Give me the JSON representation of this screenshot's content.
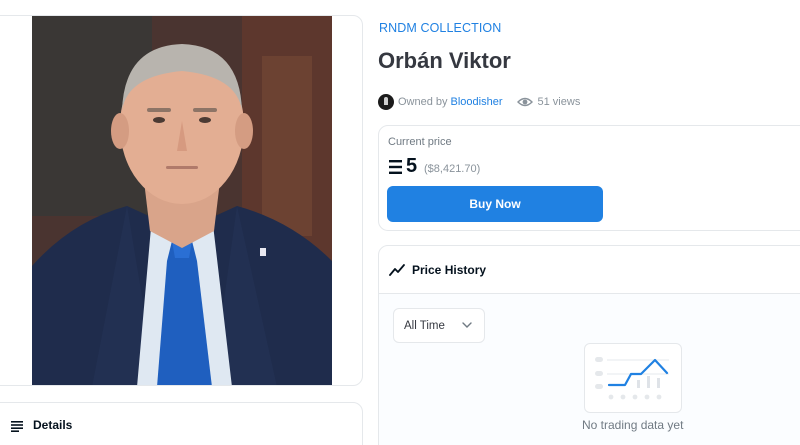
{
  "asset": {
    "collection": "RNDM COLLECTION",
    "title": "Orbán Viktor",
    "owned_by_label": "Owned by",
    "owner_name": "Bloodisher",
    "views": "51 views"
  },
  "price": {
    "label": "Current price",
    "eth_value": "5",
    "usd_value": "($8,421.70)",
    "buy_label": "Buy Now"
  },
  "price_history": {
    "label": "Price History",
    "range_selected": "All Time",
    "empty_message": "No trading data yet"
  },
  "details": {
    "label": "Details"
  },
  "colors": {
    "accent": "#2081e2",
    "text": "#04111d",
    "muted": "#8a939b",
    "border": "#e5e8eb"
  },
  "icons": {
    "details": "list-icon",
    "history": "trend-line-icon",
    "views": "eye-icon",
    "currency": "ethereum-icon",
    "dropdown": "chevron-down-icon"
  }
}
